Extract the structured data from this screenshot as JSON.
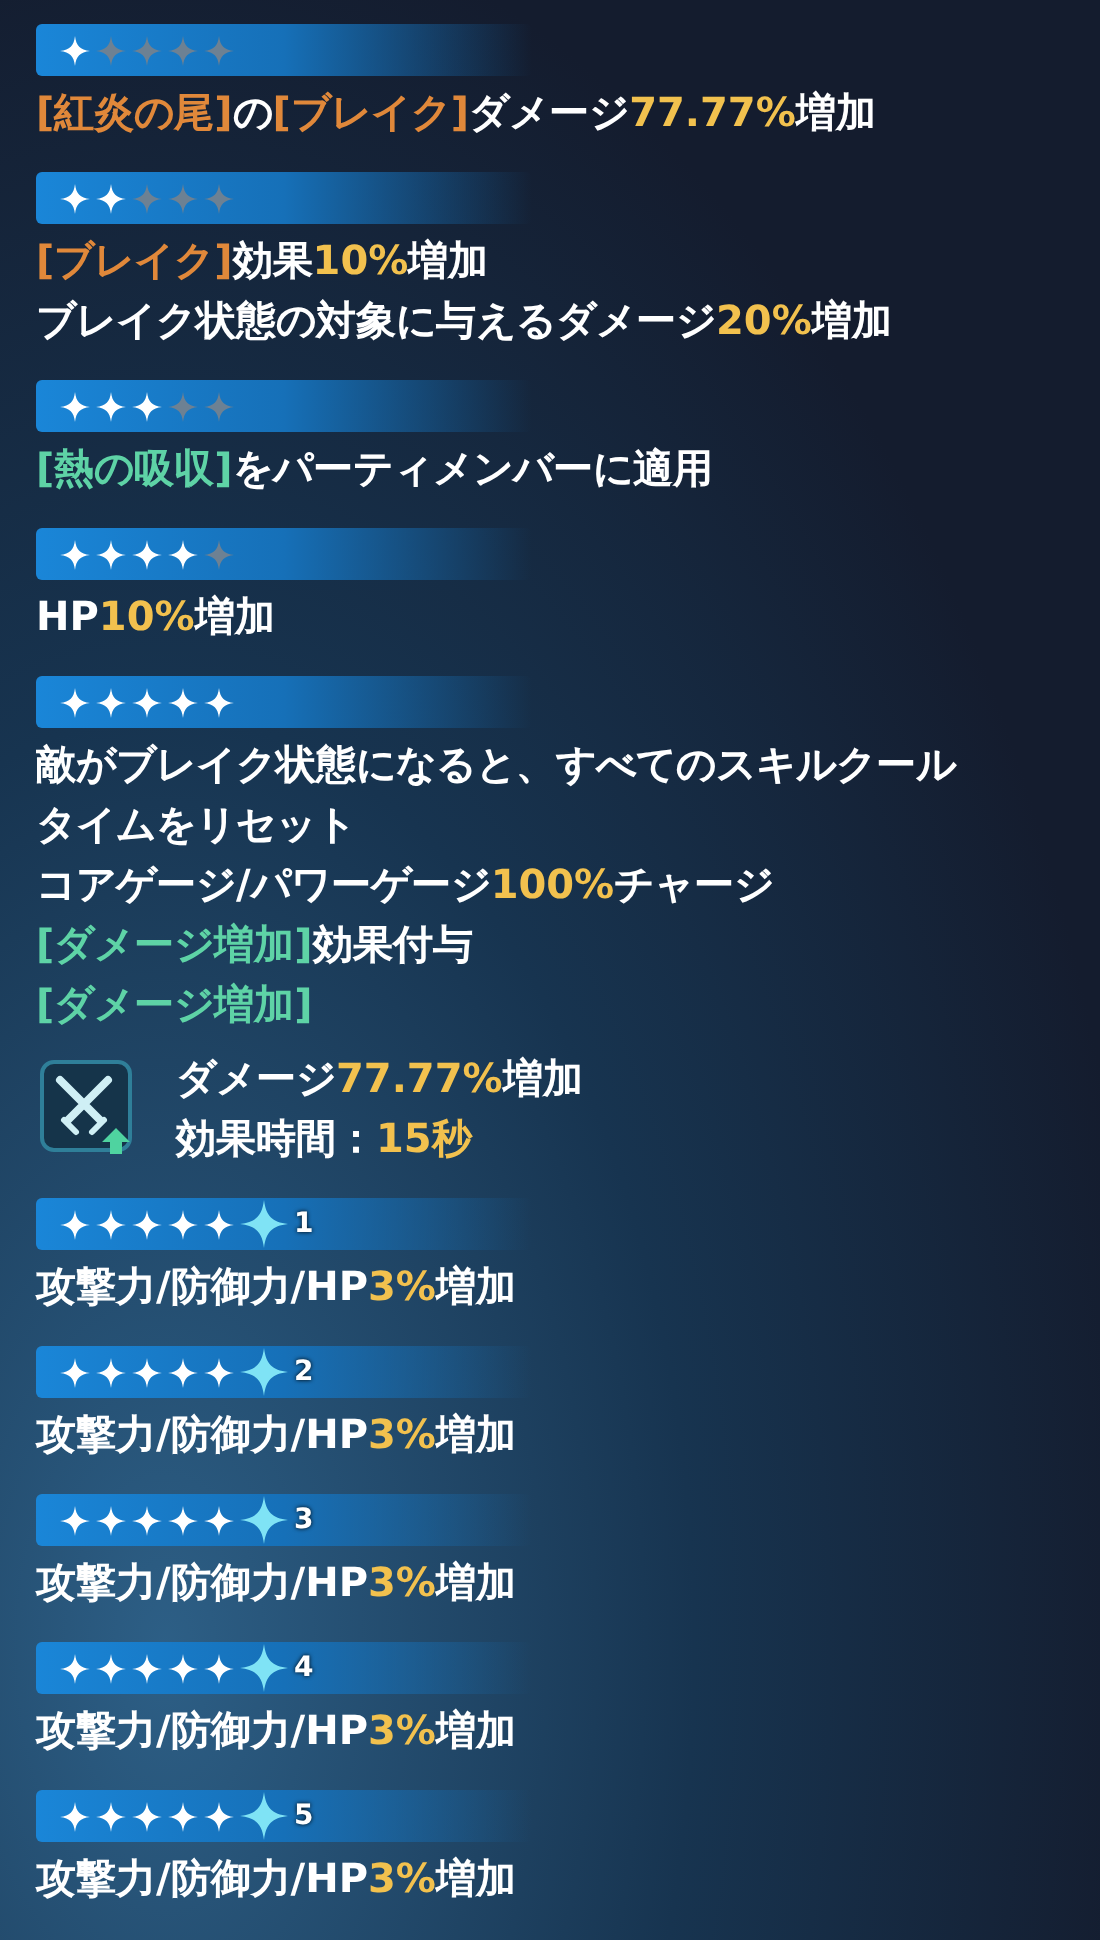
{
  "tiers": [
    {
      "kind": "basic",
      "stars": 1,
      "lines": [
        [
          {
            "kind": "keyword",
            "text": "[紅炎の尾]"
          },
          {
            "kind": "plain",
            "text": "の"
          },
          {
            "kind": "keyword",
            "text": "[ブレイク]"
          },
          {
            "kind": "plain",
            "text": "ダメージ"
          },
          {
            "kind": "value",
            "text": "77.77%"
          },
          {
            "kind": "plain",
            "text": "増加"
          }
        ]
      ]
    },
    {
      "kind": "basic",
      "stars": 2,
      "lines": [
        [
          {
            "kind": "keyword",
            "text": "[ブレイク]"
          },
          {
            "kind": "plain",
            "text": "効果"
          },
          {
            "kind": "value",
            "text": "10%"
          },
          {
            "kind": "plain",
            "text": "増加"
          }
        ],
        [
          {
            "kind": "plain",
            "text": "ブレイク状態の対象に与えるダメージ"
          },
          {
            "kind": "value",
            "text": "20%"
          },
          {
            "kind": "plain",
            "text": "増加"
          }
        ]
      ]
    },
    {
      "kind": "basic",
      "stars": 3,
      "lines": [
        [
          {
            "kind": "buff",
            "text": "[熱の吸収]"
          },
          {
            "kind": "plain",
            "text": "をパーティメンバーに適用"
          }
        ]
      ]
    },
    {
      "kind": "basic",
      "stars": 4,
      "lines": [
        [
          {
            "kind": "plain",
            "text": "HP"
          },
          {
            "kind": "value",
            "text": "10%"
          },
          {
            "kind": "plain",
            "text": "増加"
          }
        ]
      ]
    },
    {
      "kind": "basic",
      "stars": 5,
      "lines": [
        [
          {
            "kind": "plain",
            "text": "敵がブレイク状態になると、すべてのスキルクールタイムをリセット"
          }
        ],
        [
          {
            "kind": "plain",
            "text": "コアゲージ/パワーゲージ"
          },
          {
            "kind": "value",
            "text": "100%"
          },
          {
            "kind": "plain",
            "text": "チャージ"
          }
        ],
        [
          {
            "kind": "buff",
            "text": "[ダメージ増加]"
          },
          {
            "kind": "plain",
            "text": "効果付与"
          }
        ],
        [
          {
            "kind": "buff",
            "text": "[ダメージ増加]"
          }
        ]
      ],
      "buff": {
        "lines": [
          [
            {
              "kind": "plain",
              "text": "ダメージ"
            },
            {
              "kind": "value",
              "text": "77.77%"
            },
            {
              "kind": "plain",
              "text": "増加"
            }
          ],
          [
            {
              "kind": "plain",
              "text": "効果時間："
            },
            {
              "kind": "value",
              "text": "15秒"
            }
          ]
        ]
      }
    },
    {
      "kind": "upgrade",
      "stars": 5,
      "rank": "1",
      "lines": [
        [
          {
            "kind": "plain",
            "text": "攻撃力/防御力/HP"
          },
          {
            "kind": "value",
            "text": "3%"
          },
          {
            "kind": "plain",
            "text": "増加"
          }
        ]
      ]
    },
    {
      "kind": "upgrade",
      "stars": 5,
      "rank": "2",
      "lines": [
        [
          {
            "kind": "plain",
            "text": "攻撃力/防御力/HP"
          },
          {
            "kind": "value",
            "text": "3%"
          },
          {
            "kind": "plain",
            "text": "増加"
          }
        ]
      ]
    },
    {
      "kind": "upgrade",
      "stars": 5,
      "rank": "3",
      "lines": [
        [
          {
            "kind": "plain",
            "text": "攻撃力/防御力/HP"
          },
          {
            "kind": "value",
            "text": "3%"
          },
          {
            "kind": "plain",
            "text": "増加"
          }
        ]
      ]
    },
    {
      "kind": "upgrade",
      "stars": 5,
      "rank": "4",
      "lines": [
        [
          {
            "kind": "plain",
            "text": "攻撃力/防御力/HP"
          },
          {
            "kind": "value",
            "text": "3%"
          },
          {
            "kind": "plain",
            "text": "増加"
          }
        ]
      ]
    },
    {
      "kind": "upgrade",
      "stars": 5,
      "rank": "5",
      "lines": [
        [
          {
            "kind": "plain",
            "text": "攻撃力/防御力/HP"
          },
          {
            "kind": "value",
            "text": "3%"
          },
          {
            "kind": "plain",
            "text": "増加"
          }
        ]
      ]
    }
  ]
}
